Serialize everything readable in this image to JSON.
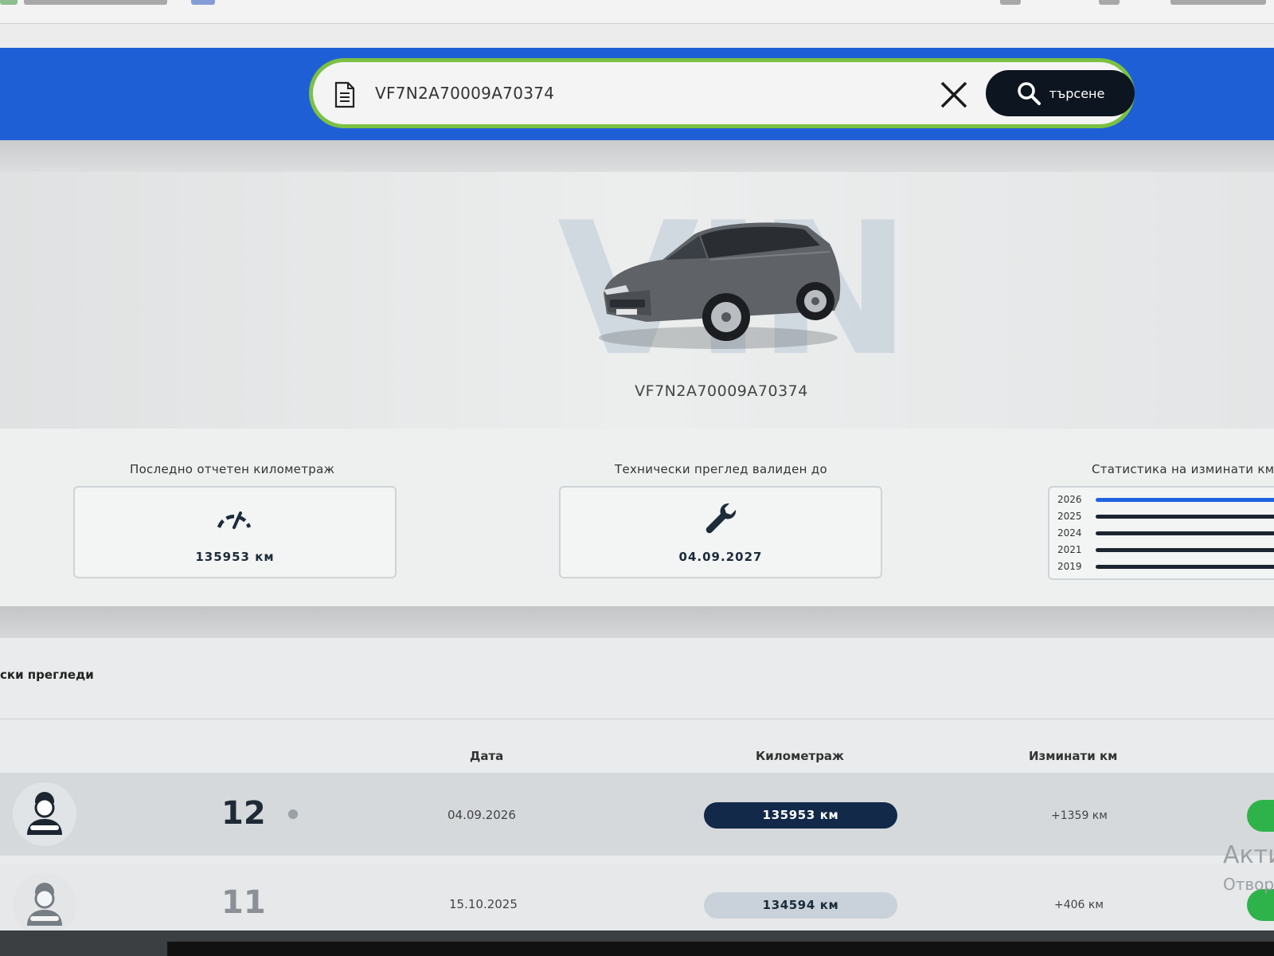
{
  "search": {
    "value": "VF7N2A70009A70374",
    "button_label": "търсене"
  },
  "vehicle": {
    "watermark": "VIN",
    "vin": "VF7N2A70009A70374"
  },
  "stats": {
    "mileage_title": "Последно отчетен километраж",
    "mileage_value": "135953 км",
    "inspection_title": "Технически преглед валиден до",
    "inspection_value": "04.09.2027",
    "chart_title": "Статистика на изминати км",
    "years": [
      {
        "year": "2026",
        "fill": 1.0,
        "color": "#1e63e0"
      },
      {
        "year": "2025",
        "fill": 1.0,
        "color": "#1a2530"
      },
      {
        "year": "2024",
        "fill": 1.0,
        "color": "#1a2530"
      },
      {
        "year": "2021",
        "fill": 1.0,
        "color": "#1a2530"
      },
      {
        "year": "2019",
        "fill": 0.96,
        "color": "#1a2530"
      }
    ]
  },
  "inspections": {
    "section_title": "ски прегледи",
    "columns": {
      "date": "Дата",
      "mileage": "Километраж",
      "driven": "Изминати км"
    },
    "rows": [
      {
        "num": "12",
        "date": "04.09.2026",
        "mileage": "135953 км",
        "driven": "+1359 км"
      },
      {
        "num": "11",
        "date": "15.10.2025",
        "mileage": "134594 км",
        "driven": "+406 км"
      }
    ]
  },
  "os_watermark": {
    "line1": "Акти",
    "line2": "Отвор"
  },
  "colors": {
    "accent_blue": "#1f5fd6",
    "search_border": "#7bc142",
    "dark": "#0d1620",
    "status_green": "#2db34a"
  }
}
